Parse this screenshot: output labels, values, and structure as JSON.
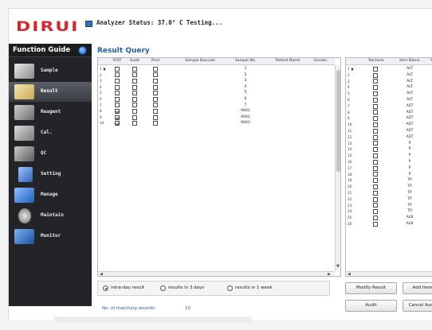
{
  "logo": "DIRUI",
  "status": "Analyzer Status: 37.0° C Testing...",
  "sidebar": {
    "title": "Function Guide",
    "items": [
      {
        "label": "Sample",
        "icon": "sample-tube-icon"
      },
      {
        "label": "Result",
        "icon": "result-document-icon",
        "active": true
      },
      {
        "label": "Reagent",
        "icon": "reagent-bottles-icon"
      },
      {
        "label": "Cal.",
        "icon": "calibration-icon"
      },
      {
        "label": "QC",
        "icon": "qc-icon"
      },
      {
        "label": "Setting",
        "icon": "setting-icon"
      },
      {
        "label": "Manage",
        "icon": "manage-users-icon"
      },
      {
        "label": "Maintain",
        "icon": "maintain-icon"
      },
      {
        "label": "Monitor",
        "icon": "monitor-icon"
      }
    ]
  },
  "main": {
    "title": "Result Query",
    "left_table": {
      "columns": [
        "STAT",
        "Audit",
        "Print",
        "Sample Barcode",
        "Sample No.",
        "Patient Name",
        "Gender"
      ],
      "rows": [
        {
          "n": "1",
          "stat": false,
          "sample_no": "1"
        },
        {
          "n": "2",
          "stat": false,
          "sample_no": "2"
        },
        {
          "n": "3",
          "stat": false,
          "sample_no": "3"
        },
        {
          "n": "4",
          "stat": false,
          "sample_no": "4"
        },
        {
          "n": "5",
          "stat": false,
          "sample_no": "5"
        },
        {
          "n": "6",
          "stat": false,
          "sample_no": "6"
        },
        {
          "n": "7",
          "stat": false,
          "sample_no": "7"
        },
        {
          "n": "8",
          "stat": true,
          "sample_no": "9001"
        },
        {
          "n": "9",
          "stat": true,
          "sample_no": "9002"
        },
        {
          "n": "10",
          "stat": true,
          "sample_no": "9003"
        }
      ]
    },
    "right_table": {
      "columns": [
        "Recheck",
        "Item Name",
        "R"
      ],
      "rows": [
        {
          "n": "1",
          "item": "ALT"
        },
        {
          "n": "2",
          "item": "ALT"
        },
        {
          "n": "3",
          "item": "ALT"
        },
        {
          "n": "4",
          "item": "ALT"
        },
        {
          "n": "5",
          "item": "ALT"
        },
        {
          "n": "6",
          "item": "ALT"
        },
        {
          "n": "7",
          "item": "AST"
        },
        {
          "n": "8",
          "item": "AST"
        },
        {
          "n": "9",
          "item": "AST"
        },
        {
          "n": "10",
          "item": "AST"
        },
        {
          "n": "11",
          "item": "AST"
        },
        {
          "n": "12",
          "item": "AST"
        },
        {
          "n": "13",
          "item": "P"
        },
        {
          "n": "14",
          "item": "P"
        },
        {
          "n": "15",
          "item": "P"
        },
        {
          "n": "16",
          "item": "P"
        },
        {
          "n": "17",
          "item": "P"
        },
        {
          "n": "18",
          "item": "P"
        },
        {
          "n": "19",
          "item": "TP"
        },
        {
          "n": "20",
          "item": "TP"
        },
        {
          "n": "21",
          "item": "TP"
        },
        {
          "n": "22",
          "item": "TP"
        },
        {
          "n": "23",
          "item": "TP"
        },
        {
          "n": "24",
          "item": "TP"
        },
        {
          "n": "25",
          "item": "ALB"
        },
        {
          "n": "26",
          "item": "ALB"
        }
      ]
    },
    "filters": {
      "options": [
        "intra-day result",
        "results in 3 days",
        "results in 1 week"
      ],
      "selected": "intra-day result"
    },
    "count": {
      "label": "No. of matching records:",
      "value": "10"
    },
    "buttons": {
      "modify": "Modify Result",
      "add": "Add Item",
      "audit": "Audit",
      "cancel_audit": "Cancel Audit"
    }
  }
}
